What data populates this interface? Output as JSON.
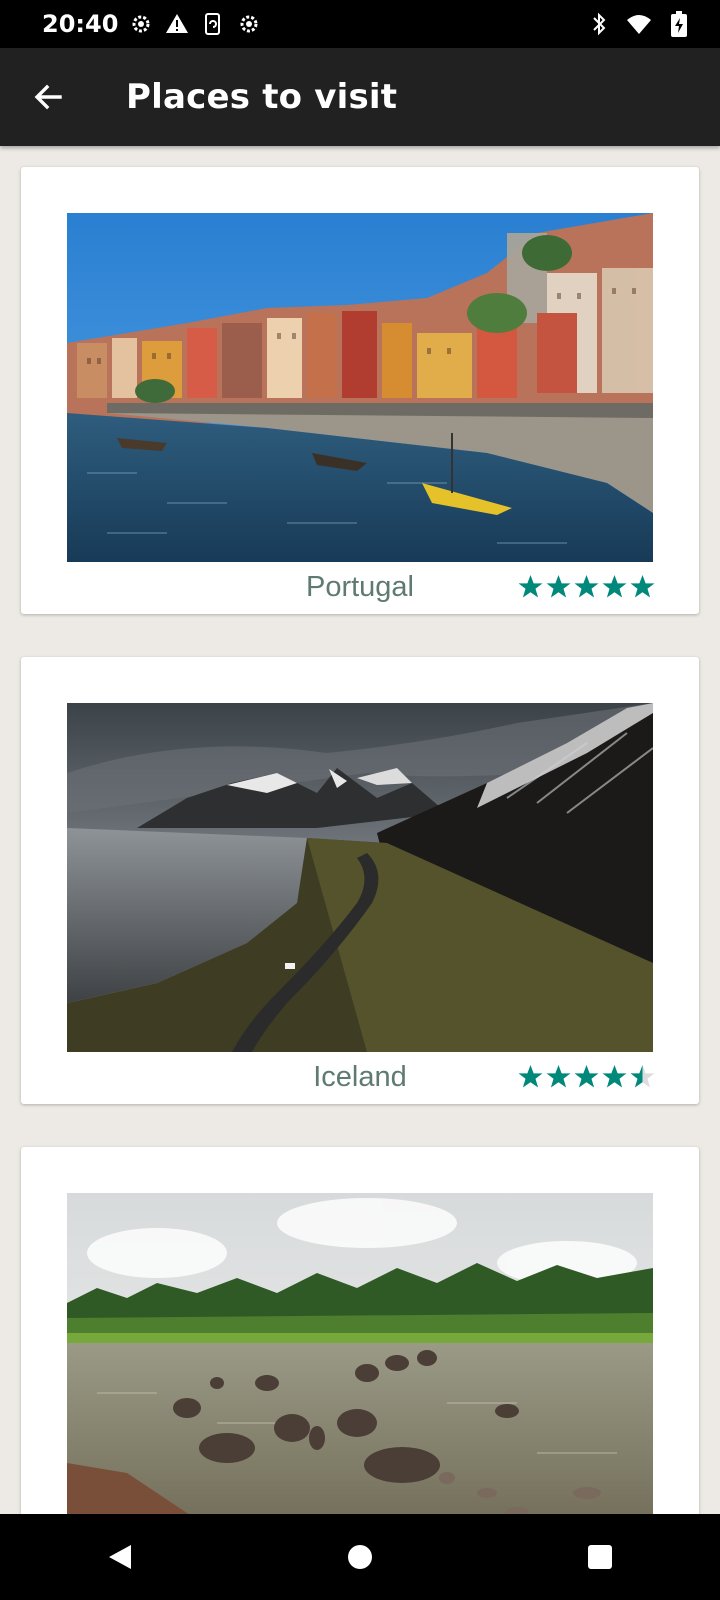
{
  "status_bar": {
    "time": "20:40",
    "left_icons": [
      "settings-gear-icon",
      "warning-icon",
      "screen-rotate-icon",
      "settings-gear-icon"
    ],
    "right_icons": [
      "bluetooth-icon",
      "wifi-icon",
      "battery-charging-icon"
    ]
  },
  "app_bar": {
    "back_icon": "arrow-back-icon",
    "title": "Places to visit"
  },
  "places": [
    {
      "name": "Portugal",
      "rating": 5,
      "max_rating": 5,
      "photo": "harbor-town-photo"
    },
    {
      "name": "Iceland",
      "rating": 4.5,
      "max_rating": 5,
      "photo": "mountain-road-photo"
    },
    {
      "name": "",
      "rating": null,
      "max_rating": 5,
      "photo": "elephants-river-photo"
    }
  ],
  "colors": {
    "star_filled": "#00897b",
    "star_empty": "#dddddd",
    "place_name": "#5f7a72",
    "app_bar": "#212121",
    "background": "#ede9e4"
  },
  "nav_bar": {
    "buttons": [
      "back-triangle-icon",
      "home-circle-icon",
      "recents-square-icon"
    ]
  }
}
